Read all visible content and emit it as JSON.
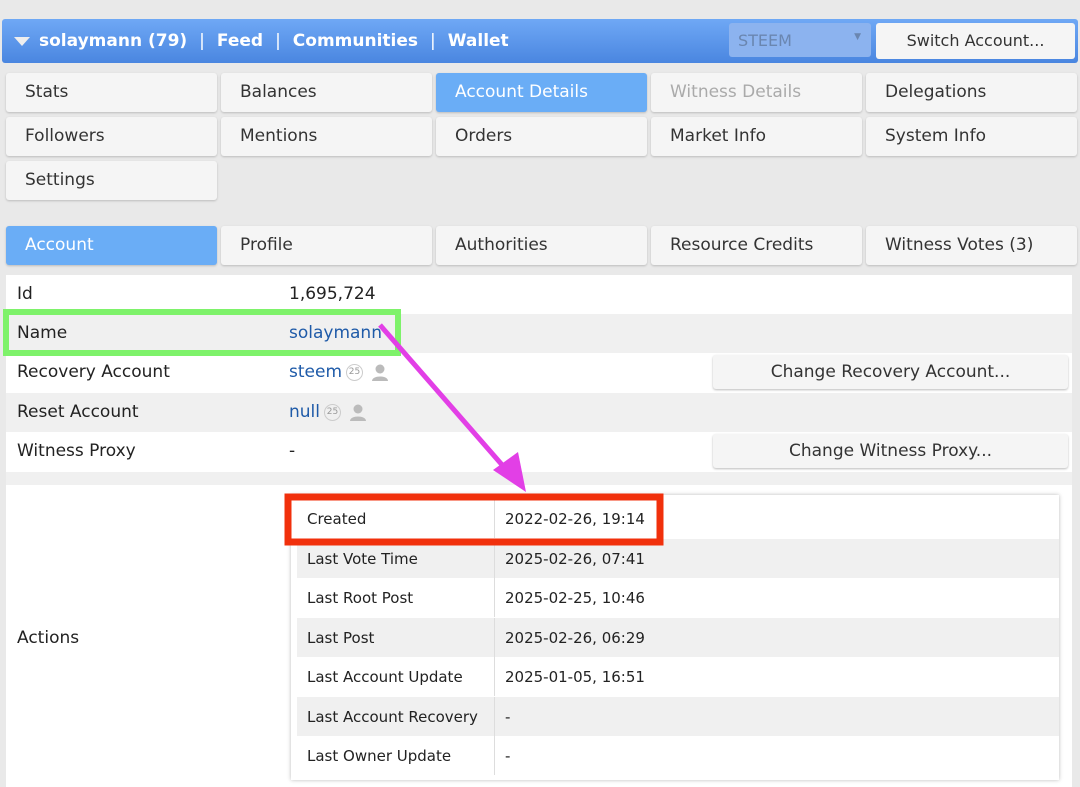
{
  "header": {
    "user": "solaymann (79)",
    "links": [
      "Feed",
      "Communities",
      "Wallet"
    ],
    "chain_select": "STEEM",
    "switch_account": "Switch Account..."
  },
  "nav": [
    [
      "Stats",
      "Balances",
      "Account Details",
      "Witness Details",
      "Delegations"
    ],
    [
      "Followers",
      "Mentions",
      "Orders",
      "Market Info",
      "System Info"
    ],
    [
      "Settings"
    ]
  ],
  "subtabs": [
    "Account",
    "Profile",
    "Authorities",
    "Resource Credits",
    "Witness Votes (3)"
  ],
  "account": {
    "id_label": "Id",
    "id": "1,695,724",
    "name_label": "Name",
    "name": "solaymann",
    "recovery_label": "Recovery Account",
    "recovery": "steem",
    "recovery_rep": "25",
    "change_recovery": "Change Recovery Account...",
    "reset_label": "Reset Account",
    "reset": "null",
    "reset_rep": "25",
    "proxy_label": "Witness Proxy",
    "proxy": "-",
    "change_proxy": "Change Witness Proxy...",
    "actions_label": "Actions"
  },
  "actions": [
    {
      "label": "Created",
      "value": "2022-02-26, 19:14"
    },
    {
      "label": "Last Vote Time",
      "value": "2025-02-26, 07:41"
    },
    {
      "label": "Last Root Post",
      "value": "2025-02-25, 10:46"
    },
    {
      "label": "Last Post",
      "value": "2025-02-26, 06:29"
    },
    {
      "label": "Last Account Update",
      "value": "2025-01-05, 16:51"
    },
    {
      "label": "Last Account Recovery",
      "value": "-"
    },
    {
      "label": "Last Owner Update",
      "value": "-"
    }
  ],
  "colors": {
    "accent": "#6aadf6",
    "highlight_green": "#7ef26a",
    "highlight_red": "#f1300c",
    "arrow": "#e23fe6"
  }
}
